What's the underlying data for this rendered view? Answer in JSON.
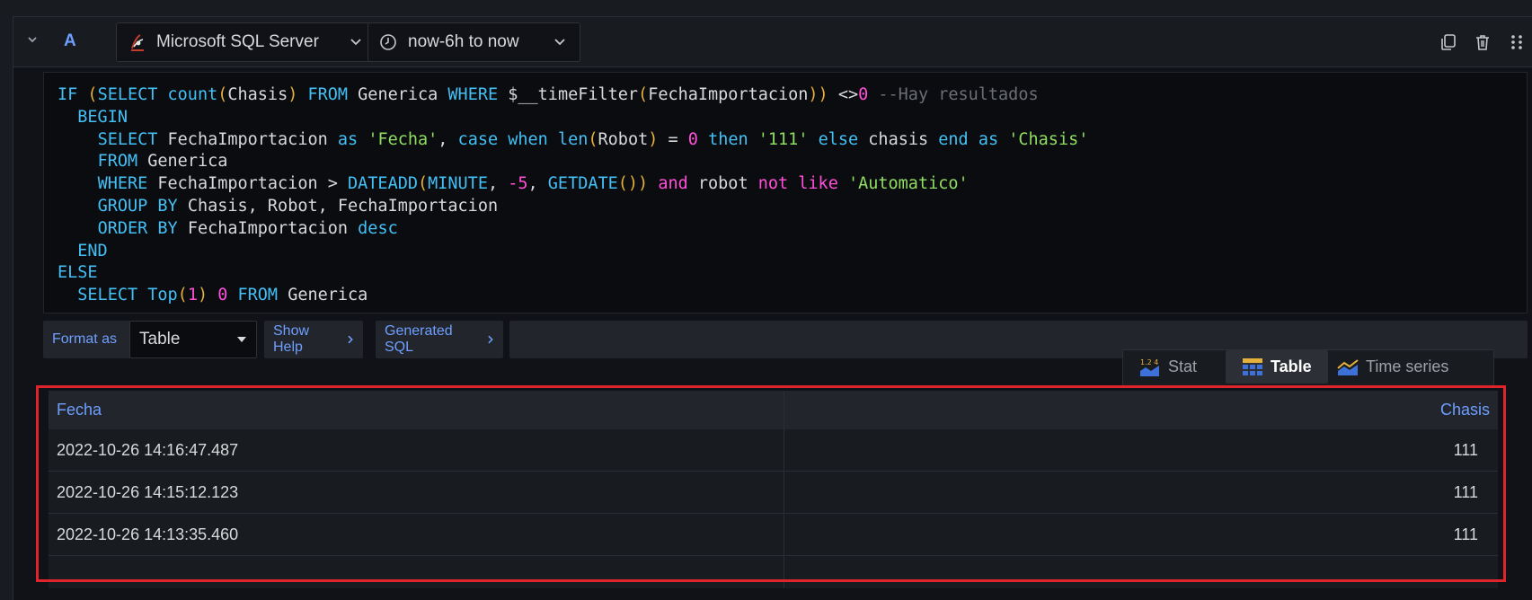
{
  "query": {
    "ref_id": "A",
    "datasource": "Microsoft SQL Server",
    "time_range": "now-6h to now"
  },
  "code_lines": [
    [
      [
        "kw",
        "IF "
      ],
      [
        "br",
        "("
      ],
      [
        "kw",
        "SELECT "
      ],
      [
        "fn",
        "count"
      ],
      [
        "br",
        "("
      ],
      [
        "t",
        "Chasis"
      ],
      [
        "br",
        ")"
      ],
      [
        "kw",
        " FROM "
      ],
      [
        "t",
        "Generica "
      ],
      [
        "kw",
        "WHERE "
      ],
      [
        "t",
        "$__timeFilter"
      ],
      [
        "br",
        "("
      ],
      [
        "t",
        "FechaImportacion"
      ],
      [
        "br",
        "))"
      ],
      [
        "t",
        " <>"
      ],
      [
        "num",
        "0"
      ],
      [
        "cm",
        " --Hay resultados"
      ]
    ],
    [
      [
        "t",
        "  "
      ],
      [
        "kw",
        "BEGIN"
      ]
    ],
    [
      [
        "t",
        "    "
      ],
      [
        "kw",
        "SELECT "
      ],
      [
        "t",
        "FechaImportacion "
      ],
      [
        "kw",
        "as "
      ],
      [
        "str",
        "'Fecha'"
      ],
      [
        "t",
        ", "
      ],
      [
        "kw",
        "case "
      ],
      [
        "kw",
        "when "
      ],
      [
        "fn",
        "len"
      ],
      [
        "br",
        "("
      ],
      [
        "t",
        "Robot"
      ],
      [
        "br",
        ")"
      ],
      [
        "t",
        " = "
      ],
      [
        "num",
        "0"
      ],
      [
        "kw",
        " then "
      ],
      [
        "str",
        "'111'"
      ],
      [
        "kw",
        " else "
      ],
      [
        "t",
        "chasis "
      ],
      [
        "kw",
        "end "
      ],
      [
        "kw",
        "as "
      ],
      [
        "str",
        "'Chasis'"
      ]
    ],
    [
      [
        "t",
        "    "
      ],
      [
        "kw",
        "FROM "
      ],
      [
        "t",
        "Generica"
      ]
    ],
    [
      [
        "t",
        "    "
      ],
      [
        "kw",
        "WHERE "
      ],
      [
        "t",
        "FechaImportacion > "
      ],
      [
        "fn",
        "DATEADD"
      ],
      [
        "br",
        "("
      ],
      [
        "kw",
        "MINUTE"
      ],
      [
        "t",
        ", "
      ],
      [
        "num",
        "-5"
      ],
      [
        "t",
        ", "
      ],
      [
        "fn",
        "GETDATE"
      ],
      [
        "br",
        "())"
      ],
      [
        "op",
        " and "
      ],
      [
        "t",
        "robot "
      ],
      [
        "op",
        "not "
      ],
      [
        "op",
        "like "
      ],
      [
        "str",
        "'Automatico'"
      ]
    ],
    [
      [
        "t",
        "    "
      ],
      [
        "kw",
        "GROUP BY "
      ],
      [
        "t",
        "Chasis, Robot, FechaImportacion"
      ]
    ],
    [
      [
        "t",
        "    "
      ],
      [
        "kw",
        "ORDER BY "
      ],
      [
        "t",
        "FechaImportacion "
      ],
      [
        "kw",
        "desc"
      ]
    ],
    [
      [
        "t",
        "  "
      ],
      [
        "kw",
        "END"
      ]
    ],
    [
      [
        "kw",
        "ELSE"
      ]
    ],
    [
      [
        "t",
        "  "
      ],
      [
        "kw",
        "SELECT "
      ],
      [
        "fn",
        "Top"
      ],
      [
        "br",
        "("
      ],
      [
        "num",
        "1"
      ],
      [
        "br",
        ")"
      ],
      [
        "t",
        " "
      ],
      [
        "num",
        "0"
      ],
      [
        "kw",
        " FROM "
      ],
      [
        "t",
        "Generica"
      ]
    ]
  ],
  "toolbar": {
    "format_as_label": "Format as",
    "format_value": "Table",
    "show_help": "Show Help",
    "generated_sql": "Generated SQL"
  },
  "viz_switch": {
    "stat": "Stat",
    "table": "Table",
    "time_series": "Time series",
    "stat_icon_text": "1.2 4",
    "active": "Table"
  },
  "table": {
    "columns": [
      "Fecha",
      "Chasis"
    ],
    "rows": [
      [
        "2022-10-26 14:16:47.487",
        "111"
      ],
      [
        "2022-10-26 14:15:12.123",
        "111"
      ],
      [
        "2022-10-26 14:13:35.460",
        "111"
      ]
    ]
  },
  "colors": {
    "accent": "#6e9fff",
    "highlight_box": "#e0242b",
    "background": "#111217"
  }
}
